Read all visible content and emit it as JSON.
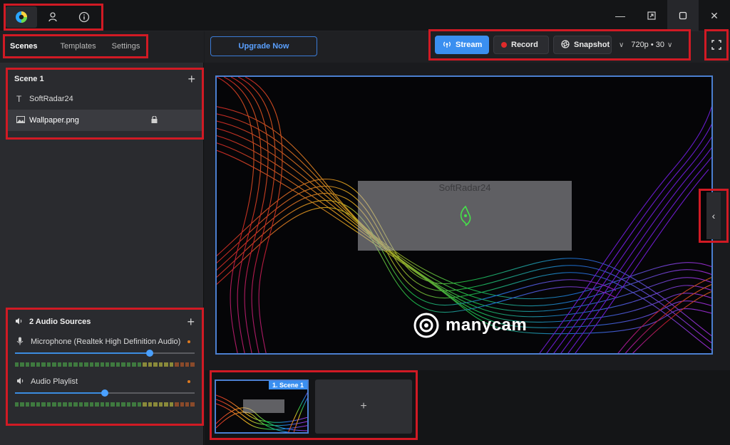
{
  "window": {
    "title_icons": [
      "manycam-logo-icon",
      "user-icon",
      "info-icon"
    ],
    "controls": [
      "minimize-icon",
      "restore-icon",
      "maximize-icon",
      "close-icon"
    ]
  },
  "sidebar": {
    "tabs": [
      {
        "label": "Scenes",
        "active": true
      },
      {
        "label": "Templates",
        "active": false
      },
      {
        "label": "Settings",
        "active": false
      }
    ],
    "scene": {
      "title": "Scene 1",
      "add": "+",
      "sources": [
        {
          "label": "SoftRadar24",
          "icon": "text-icon",
          "locked": false,
          "selected": false
        },
        {
          "label": "Wallpaper.png",
          "icon": "image-icon",
          "locked": true,
          "selected": true
        }
      ]
    },
    "audio": {
      "title": "2 Audio Sources",
      "add": "+",
      "items": [
        {
          "label": "Microphone (Realtek High Definition Audio)",
          "icon": "microphone-icon",
          "level": 0.75
        },
        {
          "label": "Audio Playlist",
          "icon": "speaker-icon",
          "level": 0.5
        }
      ]
    }
  },
  "toolbar": {
    "upgrade_label": "Upgrade Now",
    "stream_label": "Stream",
    "record_label": "Record",
    "snapshot_label": "Snapshot",
    "resolution_label": "720p • 30",
    "colors": {
      "accent": "#3a8ff0",
      "record": "#e02a2a",
      "highlight": "#d11a24"
    }
  },
  "preview": {
    "overlay_text": "SoftRadar24",
    "watermark": "manycam"
  },
  "scenes_strip": {
    "active_label": "1. Scene 1",
    "add_label": "+"
  }
}
